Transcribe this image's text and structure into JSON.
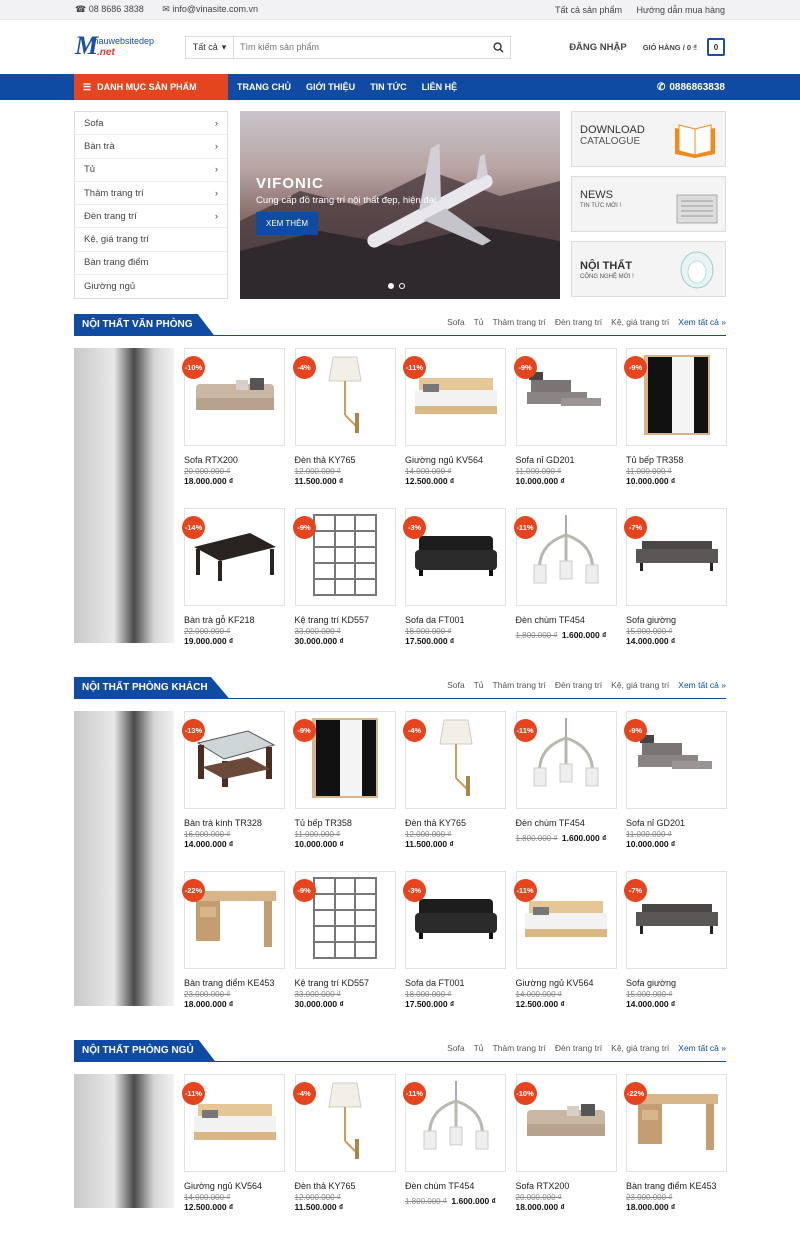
{
  "topbar": {
    "phone": "08 8686 3838",
    "email": "info@vinasite.com.vn",
    "all_products": "Tất cả sản phẩm",
    "guide": "Hướng dẫn mua hàng"
  },
  "header": {
    "logo_line1": "mauwebsitedep",
    "logo_line2": ".net",
    "search_category": "Tất cả",
    "search_placeholder": "Tìm kiếm sản phẩm",
    "login": "ĐĂNG NHẬP",
    "cart_label": "GIỎ HÀNG / 0 ₫",
    "cart_count": "0"
  },
  "nav": {
    "category_menu": "DANH MỤC SẢN PHẨM",
    "items": [
      "TRANG CHỦ",
      "GIỚI THIỆU",
      "TIN TỨC",
      "LIÊN HỆ"
    ],
    "phone": "0886863838"
  },
  "sidemenu": [
    "Sofa",
    "Bàn trà",
    "Tủ",
    "Thảm trang trí",
    "Đèn trang trí",
    "Kệ, giá trang trí",
    "Bàn trang điểm",
    "Giường ngủ"
  ],
  "slider": {
    "title": "VIFONIC",
    "subtitle": "Cung cấp đồ trang trí nội thất đẹp, hiện đại",
    "button": "XEM THÊM"
  },
  "banners": [
    {
      "title": "DOWNLOAD",
      "title2": "CATALOGUE",
      "sub": ""
    },
    {
      "title": "NEWS",
      "title2": "",
      "sub": "TIN TỨC MỚI !"
    },
    {
      "title": "NỘI THẤT",
      "title2": "",
      "sub": "CÔNG NGHỆ MỚI !"
    }
  ],
  "section_links": [
    "Sofa",
    "Tủ",
    "Thảm trang trí",
    "Đèn trang trí",
    "Kệ, giá trang trí"
  ],
  "see_all": "Xem tất cả »",
  "sections": [
    {
      "title": "NỘI THẤT VĂN PHÒNG",
      "products": [
        {
          "badge": "-10%",
          "name": "Sofa RTX200",
          "old": "20.000.000 ₫",
          "new": "18.000.000 ₫",
          "icon": "sofa"
        },
        {
          "badge": "-4%",
          "name": "Đèn thả KY765",
          "old": "12.000.000 ₫",
          "new": "11.500.000 ₫",
          "icon": "lamp"
        },
        {
          "badge": "-11%",
          "name": "Giường ngủ KV564",
          "old": "14.000.000 ₫",
          "new": "12.500.000 ₫",
          "icon": "bed"
        },
        {
          "badge": "-9%",
          "name": "Sofa nỉ GD201",
          "old": "11.000.000 ₫",
          "new": "10.000.000 ₫",
          "icon": "sofabed"
        },
        {
          "badge": "-9%",
          "name": "Tủ bếp TR358",
          "old": "11.000.000 ₫",
          "new": "10.000.000 ₫",
          "icon": "wardrobe"
        },
        {
          "badge": "-14%",
          "name": "Bàn trà gỗ KF218",
          "old": "22.000.000 ₫",
          "new": "19.000.000 ₫",
          "icon": "table"
        },
        {
          "badge": "-9%",
          "name": "Kệ trang trí KD557",
          "old": "33.000.000 ₫",
          "new": "30.000.000 ₫",
          "icon": "shelf"
        },
        {
          "badge": "-3%",
          "name": "Sofa da FT001",
          "old": "18.000.000 ₫",
          "new": "17.500.000 ₫",
          "icon": "leathersofa"
        },
        {
          "badge": "-11%",
          "name": "Đèn chùm TF454",
          "old": "1.800.000 ₫",
          "new": "1.600.000 ₫",
          "icon": "chandelier",
          "inline": true
        },
        {
          "badge": "-7%",
          "name": "Sofa giường",
          "old": "15.000.000 ₫",
          "new": "14.000.000 ₫",
          "icon": "daybed"
        }
      ]
    },
    {
      "title": "NỘI THẤT PHÒNG KHÁCH",
      "products": [
        {
          "badge": "-13%",
          "name": "Bàn trà kính TR328",
          "old": "16.000.000 ₫",
          "new": "14.000.000 ₫",
          "icon": "glasstable"
        },
        {
          "badge": "-9%",
          "name": "Tủ bếp TR358",
          "old": "11.000.000 ₫",
          "new": "10.000.000 ₫",
          "icon": "wardrobe"
        },
        {
          "badge": "-4%",
          "name": "Đèn thả KY765",
          "old": "12.000.000 ₫",
          "new": "11.500.000 ₫",
          "icon": "lamp"
        },
        {
          "badge": "-11%",
          "name": "Đèn chùm TF454",
          "old": "1.800.000 ₫",
          "new": "1.600.000 ₫",
          "icon": "chandelier",
          "inline": true
        },
        {
          "badge": "-9%",
          "name": "Sofa nỉ GD201",
          "old": "11.000.000 ₫",
          "new": "10.000.000 ₫",
          "icon": "sofabed"
        },
        {
          "badge": "-22%",
          "name": "Bàn trang điểm KE453",
          "old": "23.000.000 ₫",
          "new": "18.000.000 ₫",
          "icon": "desk"
        },
        {
          "badge": "-9%",
          "name": "Kệ trang trí KD557",
          "old": "33.000.000 ₫",
          "new": "30.000.000 ₫",
          "icon": "shelf"
        },
        {
          "badge": "-3%",
          "name": "Sofa da FT001",
          "old": "18.000.000 ₫",
          "new": "17.500.000 ₫",
          "icon": "leathersofa"
        },
        {
          "badge": "-11%",
          "name": "Giường ngủ KV564",
          "old": "14.000.000 ₫",
          "new": "12.500.000 ₫",
          "icon": "bed"
        },
        {
          "badge": "-7%",
          "name": "Sofa giường",
          "old": "15.000.000 ₫",
          "new": "14.000.000 ₫",
          "icon": "daybed"
        }
      ]
    },
    {
      "title": "NỘI THẤT PHÒNG NGỦ",
      "products": [
        {
          "badge": "-11%",
          "name": "Giường ngủ KV564",
          "old": "14.000.000 ₫",
          "new": "12.500.000 ₫",
          "icon": "bed"
        },
        {
          "badge": "-4%",
          "name": "Đèn thả KY765",
          "old": "12.000.000 ₫",
          "new": "11.500.000 ₫",
          "icon": "lamp"
        },
        {
          "badge": "-11%",
          "name": "Đèn chùm TF454",
          "old": "1.800.000 ₫",
          "new": "1.600.000 ₫",
          "icon": "chandelier",
          "inline": true
        },
        {
          "badge": "-10%",
          "name": "Sofa RTX200",
          "old": "20.000.000 ₫",
          "new": "18.000.000 ₫",
          "icon": "sofa"
        },
        {
          "badge": "-22%",
          "name": "Bàn trang điểm KE453",
          "old": "23.000.000 ₫",
          "new": "18.000.000 ₫",
          "icon": "desk"
        }
      ]
    }
  ]
}
